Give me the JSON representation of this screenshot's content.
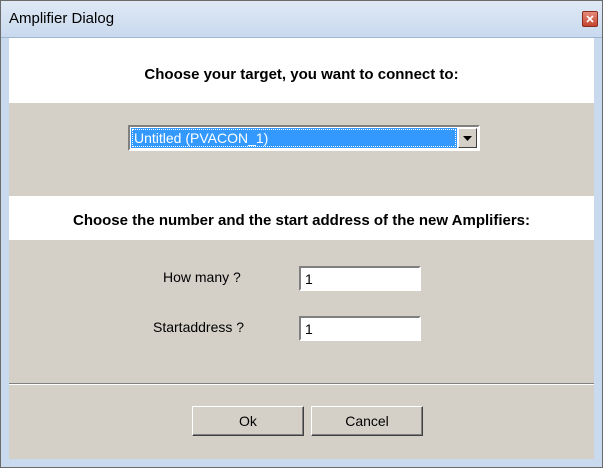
{
  "window": {
    "title": "Amplifier Dialog"
  },
  "section1": {
    "heading": "Choose your target, you want to connect to:"
  },
  "target_select": {
    "selected": "Untitled (PVACON_1)"
  },
  "section2": {
    "heading": "Choose the number and the start address of the new Amplifiers:"
  },
  "fields": {
    "how_many_label": "How many ?",
    "how_many_value": "1",
    "start_address_label": "Startaddress ?",
    "start_address_value": "1"
  },
  "buttons": {
    "ok": "Ok",
    "cancel": "Cancel"
  },
  "colors": {
    "selection": "#3399ff",
    "close": "#c4452f"
  },
  "icons": {
    "close": "close-icon",
    "dropdown": "chevron-down-icon"
  }
}
